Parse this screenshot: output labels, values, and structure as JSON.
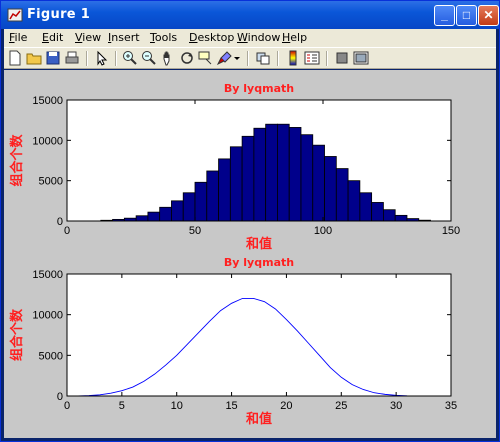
{
  "window": {
    "title": "Figure 1"
  },
  "titlebar_buttons": {
    "minimize": "_",
    "maximize": "□",
    "close": "✕"
  },
  "menu": [
    {
      "label": "File",
      "underline": "F",
      "rest": "ile"
    },
    {
      "label": "Edit",
      "underline": "E",
      "rest": "dit"
    },
    {
      "label": "View",
      "underline": "V",
      "rest": "iew"
    },
    {
      "label": "Insert",
      "underline": "I",
      "rest": "nsert"
    },
    {
      "label": "Tools",
      "underline": "T",
      "rest": "ools"
    },
    {
      "label": "Desktop",
      "underline": "D",
      "rest": "esktop"
    },
    {
      "label": "Window",
      "underline": "W",
      "rest": "indow"
    },
    {
      "label": "Help",
      "underline": "H",
      "rest": "elp"
    }
  ],
  "toolbar": [
    "new-figure-icon",
    "open-file-icon",
    "save-icon",
    "print-icon",
    "edit-plot-arrow-icon",
    "zoom-in-icon",
    "zoom-out-icon",
    "pan-hand-icon",
    "rotate-3d-icon",
    "data-cursor-icon",
    "brush-icon",
    "link-plot-icon",
    "colorbar-icon",
    "legend-icon",
    "hide-plot-tools-icon",
    "show-plot-tools-icon"
  ],
  "colors": {
    "title_red": "#ff2020",
    "bar_fill": "#00008b",
    "line_blue": "#0000ff",
    "canvas_bg": "#c8c8c8"
  },
  "chart_data": [
    {
      "type": "bar",
      "title": "By lyqmath",
      "xlabel": "和值",
      "ylabel": "组合个数",
      "xlim": [
        0,
        150
      ],
      "ylim": [
        0,
        15000
      ],
      "xticks": [
        "0",
        "50",
        "100",
        "150"
      ],
      "yticks": [
        "0",
        "5000",
        "10000",
        "15000"
      ],
      "bin_width": 4.6,
      "x": [
        15.5,
        20.1,
        24.7,
        29.3,
        33.9,
        38.5,
        43.1,
        47.7,
        52.3,
        56.9,
        61.5,
        66.1,
        70.7,
        75.3,
        79.9,
        84.5,
        89.1,
        93.7,
        98.3,
        102.9,
        107.5,
        112.1,
        116.7,
        121.3,
        125.9,
        130.5,
        135.1,
        139.7
      ],
      "values": [
        90,
        200,
        350,
        650,
        1100,
        1700,
        2500,
        3500,
        4800,
        6200,
        7700,
        9200,
        10500,
        11500,
        12000,
        12000,
        11600,
        10700,
        9400,
        8000,
        6500,
        5000,
        3500,
        2300,
        1400,
        700,
        300,
        100
      ]
    },
    {
      "type": "line",
      "title": "By lyqmath",
      "xlabel": "和值",
      "ylabel": "组合个数",
      "xlim": [
        0,
        35
      ],
      "ylim": [
        0,
        15000
      ],
      "xticks": [
        "0",
        "5",
        "10",
        "15",
        "20",
        "25",
        "30",
        "35"
      ],
      "yticks": [
        "0",
        "5000",
        "10000",
        "15000"
      ],
      "x": [
        1,
        2,
        3,
        4,
        5,
        6,
        7,
        8,
        9,
        10,
        11,
        12,
        13,
        14,
        15,
        16,
        17,
        18,
        19,
        20,
        21,
        22,
        23,
        24,
        25,
        26,
        27,
        28,
        29,
        30,
        31,
        32
      ],
      "values": [
        0,
        50,
        150,
        350,
        650,
        1100,
        1800,
        2700,
        3800,
        5000,
        6400,
        7800,
        9200,
        10500,
        11400,
        12000,
        12000,
        11600,
        10700,
        9400,
        8000,
        6500,
        5000,
        3500,
        2300,
        1400,
        800,
        400,
        200,
        80,
        20,
        0
      ]
    }
  ]
}
